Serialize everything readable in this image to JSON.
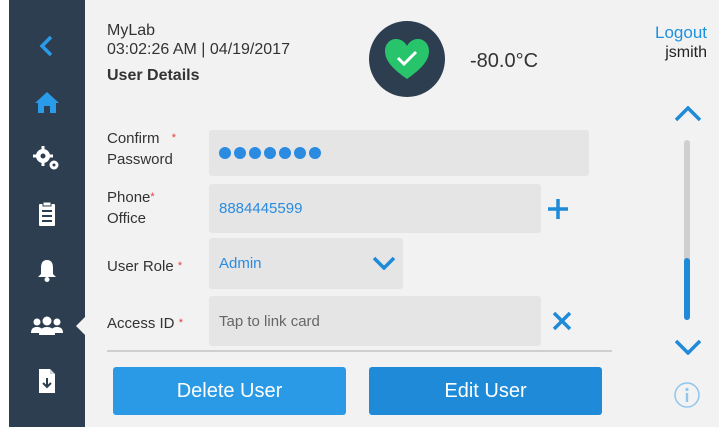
{
  "header": {
    "app_name": "MyLab",
    "timestamp": "03:02:26 AM | 04/19/2017",
    "section_title": "User Details",
    "temperature": "-80.0°C",
    "logout_label": "Logout",
    "username": "jsmith"
  },
  "sidebar": {
    "items": [
      {
        "icon": "back-icon"
      },
      {
        "icon": "home-icon"
      },
      {
        "icon": "settings-icon"
      },
      {
        "icon": "clipboard-icon"
      },
      {
        "icon": "bell-icon"
      },
      {
        "icon": "users-icon",
        "active": true
      },
      {
        "icon": "export-document-icon"
      }
    ]
  },
  "form": {
    "confirm_password": {
      "label_line1": "Confirm",
      "label_line2": "Password",
      "required": "*",
      "masked_length": 7
    },
    "phone": {
      "label_line1": "Phone",
      "label_line2": "Office",
      "required": "*",
      "value": "8884445599"
    },
    "user_role": {
      "label": "User Role",
      "required": "*",
      "value": "Admin"
    },
    "access_id": {
      "label": "Access ID",
      "required": "*",
      "placeholder": "Tap to link card"
    }
  },
  "buttons": {
    "delete_label": "Delete User",
    "edit_label": "Edit User"
  },
  "status": {
    "ok": true
  },
  "colors": {
    "accent": "#1e8ad8",
    "sidebar": "#2c3e50",
    "status_ok": "#27c46b",
    "required": "#e04040"
  }
}
